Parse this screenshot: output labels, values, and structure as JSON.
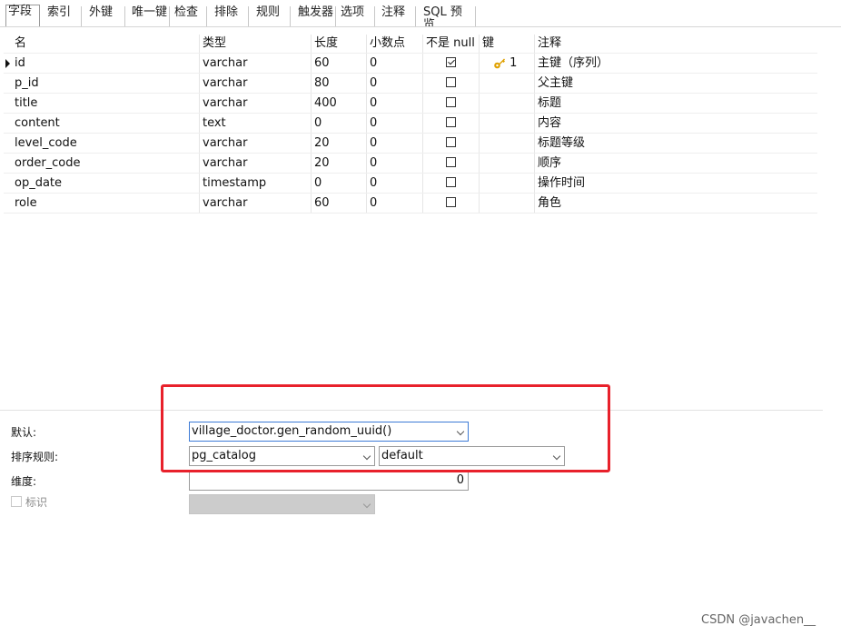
{
  "tabs": [
    "字段",
    "索引",
    "外键",
    "唯一键",
    "检查",
    "排除",
    "规则",
    "触发器",
    "选项",
    "注释",
    "SQL 预览"
  ],
  "columns": [
    "名",
    "类型",
    "长度",
    "小数点",
    "不是 null",
    "键",
    "注释"
  ],
  "rows": [
    {
      "name": "id",
      "type": "varchar",
      "length": "60",
      "decimal": "0",
      "not_null": true,
      "key": "1",
      "comment": "主键（序列）"
    },
    {
      "name": "p_id",
      "type": "varchar",
      "length": "80",
      "decimal": "0",
      "not_null": false,
      "key": "",
      "comment": "父主键"
    },
    {
      "name": "title",
      "type": "varchar",
      "length": "400",
      "decimal": "0",
      "not_null": false,
      "key": "",
      "comment": "标题"
    },
    {
      "name": "content",
      "type": "text",
      "length": "0",
      "decimal": "0",
      "not_null": false,
      "key": "",
      "comment": "内容"
    },
    {
      "name": "level_code",
      "type": "varchar",
      "length": "20",
      "decimal": "0",
      "not_null": false,
      "key": "",
      "comment": "标题等级"
    },
    {
      "name": "order_code",
      "type": "varchar",
      "length": "20",
      "decimal": "0",
      "not_null": false,
      "key": "",
      "comment": "顺序"
    },
    {
      "name": "op_date",
      "type": "timestamp",
      "length": "0",
      "decimal": "0",
      "not_null": false,
      "key": "",
      "comment": "操作时间"
    },
    {
      "name": "role",
      "type": "varchar",
      "length": "60",
      "decimal": "0",
      "not_null": false,
      "key": "",
      "comment": "角色"
    }
  ],
  "props": {
    "default_label": "默认:",
    "default_value": "village_doctor.gen_random_uuid()",
    "collation_label": "排序规则:",
    "collation_schema": "pg_catalog",
    "collation_value": "default",
    "dimension_label": "维度:",
    "dimension_value": "0",
    "identity_label": "标识"
  },
  "colors": {
    "highlight": "#e8212b",
    "key_icon": "#e0a100",
    "focus_border": "#3d7bd6"
  },
  "icons": {
    "key": "key-icon",
    "row_pointer": "row-pointer-icon"
  },
  "watermark": "CSDN @javachen__"
}
